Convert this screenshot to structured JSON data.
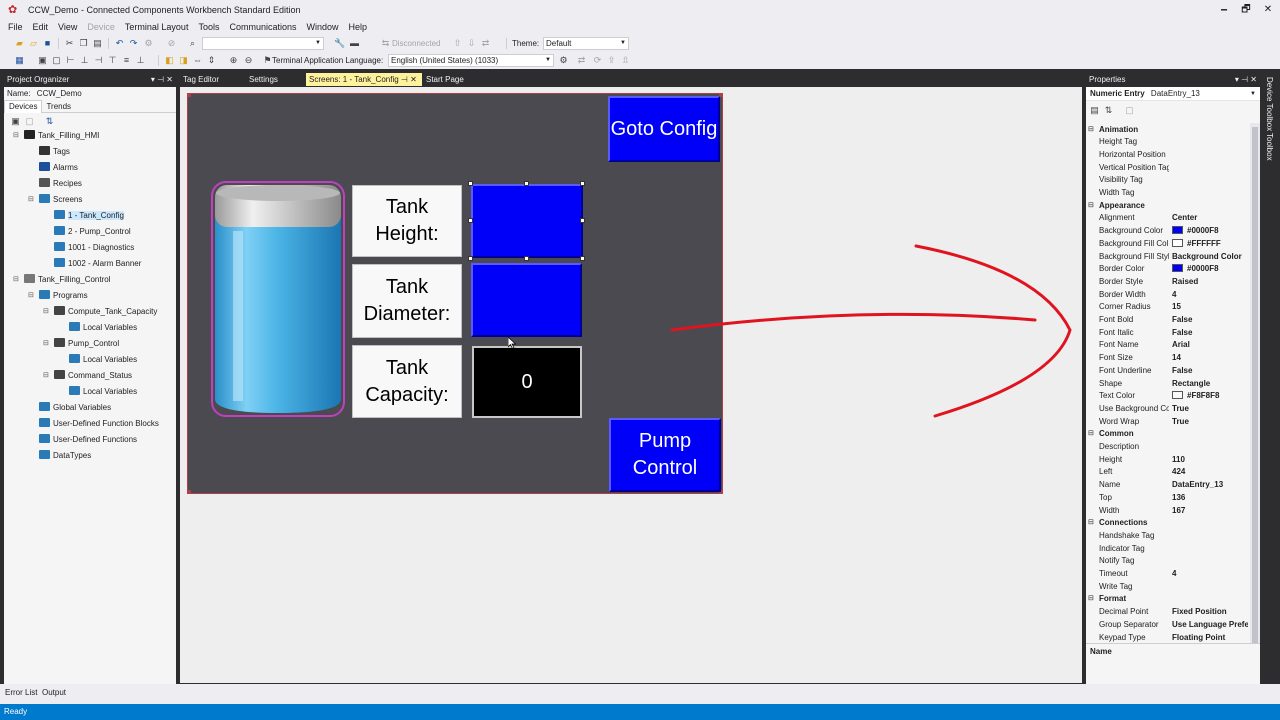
{
  "window": {
    "title": "CCW_Demo - Connected Components Workbench Standard Edition",
    "minimize": "🗕",
    "restore": "🗗",
    "close": "✕"
  },
  "menu": [
    "File",
    "Edit",
    "View",
    "Device",
    "Terminal Layout",
    "Tools",
    "Communications",
    "Window",
    "Help"
  ],
  "menu_disabled": [
    false,
    false,
    false,
    true,
    false,
    false,
    false,
    false,
    false
  ],
  "toolbar1": {
    "combo_value": "",
    "connection_status": "Disconnected",
    "theme_label": "Theme:",
    "theme_value": "Default"
  },
  "toolbar2": {
    "language_label": "Terminal Application Language:",
    "language_value": "English (United States) (1033)"
  },
  "project_organizer": {
    "header": "Project Organizer",
    "name_label": "Name:",
    "name_value": "CCW_Demo",
    "tabs": [
      "Devices",
      "Trends"
    ],
    "tree": [
      {
        "label": "Tank_Filling_HMI",
        "level": 0,
        "icon": "hmi-device-icon",
        "expander": "⊟"
      },
      {
        "label": "Tags",
        "level": 1,
        "icon": "tag-icon"
      },
      {
        "label": "Alarms",
        "level": 1,
        "icon": "alarm-bell-icon"
      },
      {
        "label": "Recipes",
        "level": 1,
        "icon": "recipe-icon"
      },
      {
        "label": "Screens",
        "level": 1,
        "icon": "screens-folder-icon",
        "expander": "⊟"
      },
      {
        "label": "1 - Tank_Config",
        "level": 2,
        "icon": "screen-icon",
        "selected": true
      },
      {
        "label": "2 - Pump_Control",
        "level": 2,
        "icon": "screen-icon"
      },
      {
        "label": "1001 - Diagnostics",
        "level": 2,
        "icon": "screen-icon"
      },
      {
        "label": "1002 - Alarm Banner",
        "level": 2,
        "icon": "screen-icon"
      },
      {
        "label": "Tank_Filling_Control",
        "level": 0,
        "icon": "controller-icon",
        "expander": "⊟"
      },
      {
        "label": "Programs",
        "level": 1,
        "icon": "programs-folder-icon",
        "expander": "⊟"
      },
      {
        "label": "Compute_Tank_Capacity",
        "level": 2,
        "icon": "program-icon",
        "expander": "⊟"
      },
      {
        "label": "Local Variables",
        "level": 3,
        "icon": "variables-icon"
      },
      {
        "label": "Pump_Control",
        "level": 2,
        "icon": "program-icon",
        "expander": "⊟"
      },
      {
        "label": "Local Variables",
        "level": 3,
        "icon": "variables-icon"
      },
      {
        "label": "Command_Status",
        "level": 2,
        "icon": "program-icon",
        "expander": "⊟"
      },
      {
        "label": "Local Variables",
        "level": 3,
        "icon": "variables-icon"
      },
      {
        "label": "Global Variables",
        "level": 1,
        "icon": "variables-icon"
      },
      {
        "label": "User-Defined Function Blocks",
        "level": 1,
        "icon": "function-block-icon"
      },
      {
        "label": "User-Defined Functions",
        "level": 1,
        "icon": "function-icon"
      },
      {
        "label": "DataTypes",
        "level": 1,
        "icon": "datatype-icon"
      }
    ]
  },
  "doc_tabs": [
    {
      "label": "Tag Editor",
      "active": false
    },
    {
      "label": "Settings",
      "active": false
    },
    {
      "label": "Screens: 1 - Tank_Config",
      "active": true,
      "pin": "⊣",
      "close": "✕"
    },
    {
      "label": "Start Page",
      "active": false
    }
  ],
  "hmi": {
    "goto_config": "Goto Config",
    "pump_control": "Pump Control",
    "tank_height_label": "Tank Height:",
    "tank_diameter_label": "Tank Diameter:",
    "tank_capacity_label": "Tank Capacity:",
    "tank_capacity_value": "0"
  },
  "properties": {
    "header": "Properties",
    "object_type": "Numeric Entry",
    "object_name": "DataEntry_13",
    "name_footer": "Name",
    "categories": [
      {
        "name": "Animation",
        "props": [
          {
            "name": "Height Tag",
            "value": ""
          },
          {
            "name": "Horizontal Position",
            "value": ""
          },
          {
            "name": "Vertical Position Tag",
            "value": ""
          },
          {
            "name": "Visibility Tag",
            "value": ""
          },
          {
            "name": "Width Tag",
            "value": ""
          }
        ]
      },
      {
        "name": "Appearance",
        "props": [
          {
            "name": "Alignment",
            "value": "Center"
          },
          {
            "name": "Background Color",
            "value": "#0000F8",
            "swatch": "#0000f8"
          },
          {
            "name": "Background Fill Col",
            "value": "#FFFFFF",
            "swatch": "#ffffff"
          },
          {
            "name": "Background Fill Styl",
            "value": "Background Color"
          },
          {
            "name": "Border Color",
            "value": "#0000F8",
            "swatch": "#0000f8"
          },
          {
            "name": "Border Style",
            "value": "Raised"
          },
          {
            "name": "Border Width",
            "value": "4"
          },
          {
            "name": "Corner Radius",
            "value": "15"
          },
          {
            "name": "Font Bold",
            "value": "False"
          },
          {
            "name": "Font Italic",
            "value": "False"
          },
          {
            "name": "Font Name",
            "value": "Arial"
          },
          {
            "name": "Font Size",
            "value": "14"
          },
          {
            "name": "Font Underline",
            "value": "False"
          },
          {
            "name": "Shape",
            "value": "Rectangle"
          },
          {
            "name": "Text Color",
            "value": "#F8F8F8",
            "swatch": "#f8f8f8"
          },
          {
            "name": "Use Background Co",
            "value": "True"
          },
          {
            "name": "Word Wrap",
            "value": "True"
          }
        ]
      },
      {
        "name": "Common",
        "props": [
          {
            "name": "Description",
            "value": ""
          },
          {
            "name": "Height",
            "value": "110"
          },
          {
            "name": "Left",
            "value": "424"
          },
          {
            "name": "Name",
            "value": "DataEntry_13"
          },
          {
            "name": "Top",
            "value": "136"
          },
          {
            "name": "Width",
            "value": "167"
          }
        ]
      },
      {
        "name": "Connections",
        "props": [
          {
            "name": "Handshake Tag",
            "value": ""
          },
          {
            "name": "Indicator Tag",
            "value": ""
          },
          {
            "name": "Notify Tag",
            "value": ""
          },
          {
            "name": "Timeout",
            "value": "4"
          },
          {
            "name": "Write Tag",
            "value": ""
          }
        ]
      },
      {
        "name": "Format",
        "props": [
          {
            "name": "Decimal Point",
            "value": "Fixed Position"
          },
          {
            "name": "Group Separator",
            "value": "Use Language Prefe"
          },
          {
            "name": "Keypad Type",
            "value": "Floating Point"
          }
        ]
      }
    ]
  },
  "side_tabs": [
    "Device Toolbox",
    "Toolbox"
  ],
  "bottom_tabs": [
    "Error List",
    "Output"
  ],
  "status": "Ready",
  "colors": {
    "accent": "#007acc",
    "hmi_blue": "#0000f8",
    "annotation_red": "#e0141e"
  }
}
